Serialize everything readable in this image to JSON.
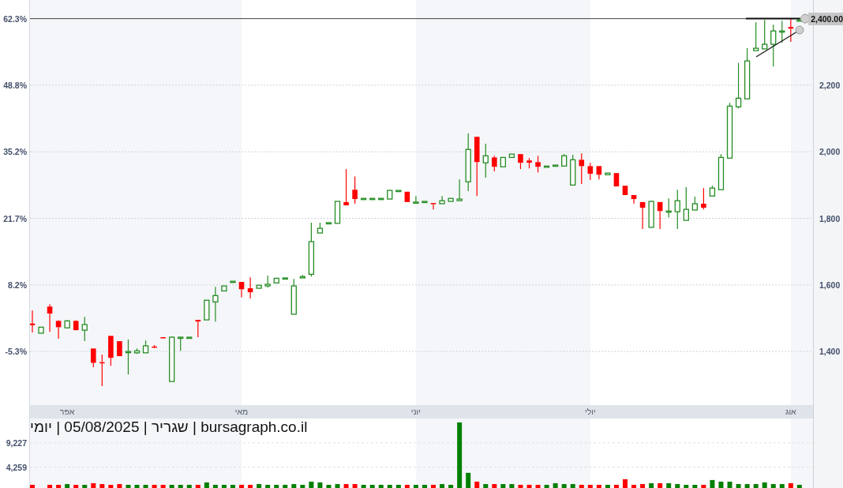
{
  "price_chart": {
    "chart_data": {
      "type": "candlestick",
      "ylim": [
        1239,
        2456
      ],
      "categories": [
        null,
        null,
        null,
        null,
        "אפר",
        null,
        null,
        null,
        null,
        null,
        null,
        null,
        null,
        null,
        null,
        null,
        null,
        null,
        null,
        null,
        null,
        null,
        null,
        null,
        "מאי",
        null,
        null,
        null,
        null,
        null,
        null,
        null,
        null,
        null,
        null,
        null,
        null,
        null,
        null,
        null,
        null,
        null,
        null,
        null,
        "יוני",
        null,
        null,
        null,
        null,
        null,
        null,
        null,
        null,
        null,
        null,
        null,
        null,
        null,
        null,
        null,
        null,
        null,
        null,
        null,
        "יולי",
        null,
        null,
        null,
        null,
        null,
        null,
        null,
        null,
        null,
        null,
        null,
        null,
        null,
        null,
        null,
        null,
        null,
        null,
        null,
        null,
        null,
        null,
        "אוג",
        null
      ],
      "yticks": [
        {
          "value": 1400,
          "label": "1,400"
        },
        {
          "value": 1600,
          "label": "1,600"
        },
        {
          "value": 1800,
          "label": "1,800"
        },
        {
          "value": 2000,
          "label": "2,000"
        },
        {
          "value": 2200,
          "label": "2,200"
        }
      ],
      "ohlc": [
        [
          1484,
          1523,
          1457,
          1479
        ],
        [
          1455,
          1473,
          1455,
          1473
        ],
        [
          1535,
          1542,
          1459,
          1514
        ],
        [
          1492,
          1494,
          1438,
          1473
        ],
        [
          1471,
          1494,
          1471,
          1492
        ],
        [
          1492,
          1494,
          1464,
          1464
        ],
        [
          1464,
          1504,
          1431,
          1481
        ],
        [
          1409,
          1409,
          1353,
          1366
        ],
        [
          1368,
          1391,
          1296,
          1366
        ],
        [
          1447,
          1447,
          1357,
          1381
        ],
        [
          1431,
          1431,
          1386,
          1386
        ],
        [
          1397,
          1436,
          1331,
          1400
        ],
        [
          1396,
          1409,
          1393,
          1402
        ],
        [
          1396,
          1433,
          1396,
          1417
        ],
        [
          1415,
          1419,
          1410,
          1412
        ],
        [
          1443,
          1443,
          1440,
          1440
        ],
        [
          1310,
          1445,
          1310,
          1443
        ],
        [
          1440,
          1443,
          1402,
          1443
        ],
        [
          1441,
          1443,
          1441,
          1443
        ],
        [
          1495,
          1495,
          1443,
          1490
        ],
        [
          1495,
          1554,
          1495,
          1554
        ],
        [
          1549,
          1594,
          1490,
          1568
        ],
        [
          1582,
          1597,
          1582,
          1597
        ],
        [
          1608,
          1611,
          1608,
          1611
        ],
        [
          1609,
          1609,
          1563,
          1587
        ],
        [
          1590,
          1623,
          1559,
          1578
        ],
        [
          1590,
          1599,
          1590,
          1599
        ],
        [
          1597,
          1628,
          1592,
          1602
        ],
        [
          1606,
          1620,
          1606,
          1620
        ],
        [
          1618,
          1621,
          1618,
          1621
        ],
        [
          1512,
          1618,
          1512,
          1597
        ],
        [
          1621,
          1630,
          1621,
          1625
        ],
        [
          1632,
          1787,
          1625,
          1730
        ],
        [
          1756,
          1787,
          1756,
          1770
        ],
        [
          1785,
          1787,
          1785,
          1787
        ],
        [
          1785,
          1851,
          1785,
          1851
        ],
        [
          1849,
          1948,
          1839,
          1839
        ],
        [
          1886,
          1926,
          1844,
          1858
        ],
        [
          1858,
          1860,
          1858,
          1860
        ],
        [
          1858,
          1860,
          1858,
          1860
        ],
        [
          1858,
          1860,
          1858,
          1860
        ],
        [
          1858,
          1884,
          1858,
          1884
        ],
        [
          1882,
          1884,
          1882,
          1884
        ],
        [
          1880,
          1880,
          1849,
          1849
        ],
        [
          1847,
          1867,
          1847,
          1849
        ],
        [
          1849,
          1851,
          1849,
          1851
        ],
        [
          1846,
          1846,
          1827,
          1844
        ],
        [
          1844,
          1867,
          1844,
          1853
        ],
        [
          1851,
          1860,
          1851,
          1860
        ],
        [
          1853,
          1917,
          1853,
          1858
        ],
        [
          1910,
          2055,
          1882,
          2007
        ],
        [
          2045,
          2045,
          1867,
          1969
        ],
        [
          1967,
          2024,
          1922,
          1988
        ],
        [
          1983,
          1988,
          1941,
          1955
        ],
        [
          1955,
          1983,
          1955,
          1983
        ],
        [
          1983,
          1993,
          1983,
          1993
        ],
        [
          1993,
          1993,
          1948,
          1967
        ],
        [
          1974,
          1981,
          1950,
          1967
        ],
        [
          1969,
          1988,
          1938,
          1955
        ],
        [
          1955,
          1957,
          1955,
          1957
        ],
        [
          1957,
          1960,
          1957,
          1960
        ],
        [
          1957,
          1993,
          1957,
          1988
        ],
        [
          1900,
          1991,
          1900,
          1976
        ],
        [
          1976,
          1995,
          1903,
          1957
        ],
        [
          1957,
          1967,
          1915,
          1934
        ],
        [
          1957,
          1957,
          1917,
          1931
        ],
        [
          1931,
          1936,
          1931,
          1936
        ],
        [
          1936,
          1936,
          1896,
          1896
        ],
        [
          1898,
          1898,
          1870,
          1870
        ],
        [
          1870,
          1870,
          1844,
          1858
        ],
        [
          1849,
          1849,
          1768,
          1832
        ],
        [
          1773,
          1853,
          1773,
          1851
        ],
        [
          1849,
          1849,
          1768,
          1822
        ],
        [
          1820,
          1860,
          1803,
          1822
        ],
        [
          1820,
          1886,
          1768,
          1853
        ],
        [
          1794,
          1894,
          1794,
          1827
        ],
        [
          1825,
          1865,
          1825,
          1844
        ],
        [
          1844,
          1891,
          1827,
          1832
        ],
        [
          1867,
          1898,
          1867,
          1891
        ],
        [
          1886,
          1993,
          1886,
          1983
        ],
        [
          1981,
          2147,
          1981,
          2137
        ],
        [
          2135,
          2267,
          2130,
          2161
        ],
        [
          2159,
          2311,
          2159,
          2273
        ],
        [
          2304,
          2389,
          2304,
          2311
        ],
        [
          2309,
          2396,
          2309,
          2323
        ],
        [
          2323,
          2382,
          2256,
          2363
        ],
        [
          2361,
          2394,
          2328,
          2363
        ],
        [
          2375,
          2401,
          2330,
          2370
        ],
        [
          2394,
          2403,
          2392,
          2396
        ]
      ],
      "grid": true,
      "ref_lines": [
        {
          "axis": "y",
          "value": 2400,
          "label": "2,400.00"
        }
      ]
    },
    "percent_ticks": [
      "62.3%",
      "48.8%",
      "35.2%",
      "21.7%",
      "8.2%",
      "-5.3%"
    ]
  },
  "volume_chart": {
    "caption": "bursagraph.co.il | שגריר | 05/08/2025 | יומי",
    "chart_data": {
      "type": "bar",
      "ylim": [
        0,
        14200
      ],
      "yticks": [
        {
          "value": 9227,
          "label": "9,227"
        },
        {
          "value": 4259,
          "label": "4,259"
        }
      ],
      "series": [
        {
          "color": "#008000",
          "values": [
            null,
            null,
            null,
            null,
            800,
            null,
            650,
            null,
            null,
            null,
            null,
            650,
            650,
            650,
            null,
            null,
            650,
            650,
            650,
            null,
            1140,
            650,
            650,
            650,
            null,
            null,
            800,
            650,
            650,
            650,
            800,
            650,
            1300,
            1140,
            650,
            800,
            null,
            null,
            650,
            650,
            650,
            650,
            650,
            null,
            650,
            650,
            null,
            800,
            650,
            13400,
            3100,
            null,
            800,
            null,
            800,
            800,
            null,
            null,
            null,
            650,
            980,
            800,
            800,
            null,
            null,
            null,
            650,
            null,
            null,
            null,
            null,
            980,
            null,
            980,
            800,
            650,
            650,
            null,
            1630,
            1300,
            1300,
            800,
            800,
            800,
            1140,
            800,
            800,
            null,
            650
          ]
        },
        {
          "color": "#ff0000",
          "values": [
            650,
            null,
            650,
            650,
            null,
            650,
            null,
            980,
            800,
            650,
            800,
            null,
            null,
            null,
            650,
            650,
            null,
            null,
            null,
            650,
            null,
            null,
            null,
            null,
            650,
            650,
            null,
            null,
            null,
            null,
            null,
            null,
            null,
            null,
            null,
            null,
            800,
            800,
            null,
            null,
            null,
            null,
            null,
            650,
            null,
            null,
            650,
            null,
            null,
            null,
            null,
            1300,
            null,
            800,
            null,
            null,
            650,
            650,
            650,
            null,
            null,
            null,
            null,
            650,
            650,
            650,
            null,
            650,
            1800,
            650,
            800,
            null,
            980,
            null,
            null,
            null,
            null,
            650,
            null,
            null,
            null,
            null,
            null,
            null,
            null,
            null,
            null,
            980,
            null
          ]
        }
      ]
    }
  }
}
